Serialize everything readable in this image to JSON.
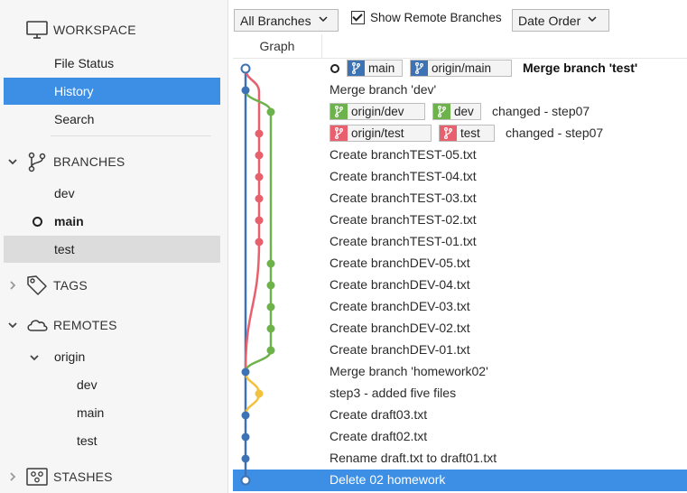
{
  "colors": {
    "accent": "#3d8fe6",
    "lane_main": "#3d73b4",
    "lane_test": "#e8606e",
    "lane_dev": "#6db24a",
    "lane_homework": "#f2c13d"
  },
  "sidebar": {
    "workspace": {
      "title": "WORKSPACE",
      "icon": "monitor-icon",
      "items": [
        {
          "label": "File Status"
        },
        {
          "label": "History",
          "selected": true
        },
        {
          "label": "Search"
        }
      ]
    },
    "branches": {
      "title": "BRANCHES",
      "icon": "branch-icon",
      "items": [
        {
          "label": "dev"
        },
        {
          "label": "main",
          "current": true
        },
        {
          "label": "test",
          "highlighted": true
        }
      ]
    },
    "tags": {
      "title": "TAGS",
      "icon": "tag-icon"
    },
    "remotes": {
      "title": "REMOTES",
      "icon": "cloud-icon",
      "origin": {
        "label": "origin",
        "items": [
          {
            "label": "dev"
          },
          {
            "label": "main"
          },
          {
            "label": "test"
          }
        ]
      }
    },
    "stashes": {
      "title": "STASHES",
      "icon": "stash-icon"
    }
  },
  "toolbar": {
    "branches_filter": "All Branches",
    "show_remote_label": "Show Remote Branches",
    "show_remote_checked": true,
    "order": "Date Order"
  },
  "history": {
    "graph_header": "Graph",
    "rows": [
      {
        "message": "Merge branch 'test'",
        "bold": true,
        "tags": [
          {
            "label": "main",
            "color": "#3d73b4"
          },
          {
            "label": "origin/main",
            "color": "#3d73b4"
          }
        ],
        "head": true
      },
      {
        "message": "Merge branch 'dev'"
      },
      {
        "message": "changed - step07",
        "tags": [
          {
            "label": "origin/dev",
            "color": "#6db24a"
          },
          {
            "label": "dev",
            "color": "#6db24a"
          }
        ]
      },
      {
        "message": "changed - step07",
        "tags": [
          {
            "label": "origin/test",
            "color": "#e8606e"
          },
          {
            "label": "test",
            "color": "#e8606e"
          }
        ]
      },
      {
        "message": "Create branchTEST-05.txt"
      },
      {
        "message": "Create branchTEST-04.txt"
      },
      {
        "message": "Create branchTEST-03.txt"
      },
      {
        "message": "Create branchTEST-02.txt"
      },
      {
        "message": "Create branchTEST-01.txt"
      },
      {
        "message": "Create branchDEV-05.txt"
      },
      {
        "message": "Create branchDEV-04.txt"
      },
      {
        "message": "Create branchDEV-03.txt"
      },
      {
        "message": "Create branchDEV-02.txt"
      },
      {
        "message": "Create branchDEV-01.txt"
      },
      {
        "message": "Merge branch 'homework02'"
      },
      {
        "message": "step3 - added five files"
      },
      {
        "message": "Create draft03.txt"
      },
      {
        "message": "Create draft02.txt"
      },
      {
        "message": "Rename draft.txt to draft01.txt"
      },
      {
        "message": "Delete 02 homework",
        "selected": true
      }
    ]
  }
}
